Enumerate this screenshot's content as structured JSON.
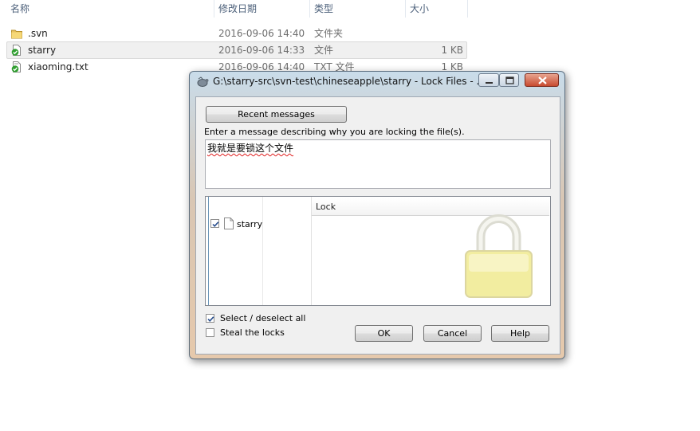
{
  "explorer": {
    "headers": {
      "name": "名称",
      "modified": "修改日期",
      "type": "类型",
      "size": "大小"
    },
    "files": [
      {
        "name": ".svn",
        "modified": "2016-09-06 14:40",
        "type": "文件夹",
        "size": "",
        "icon": "folder-icon"
      },
      {
        "name": "starry",
        "modified": "2016-09-06 14:33",
        "type": "文件",
        "size": "1 KB",
        "icon": "svn-normal-file-icon"
      },
      {
        "name": "xiaoming.txt",
        "modified": "2016-09-06 14:40",
        "type": "TXT 文件",
        "size": "1 KB",
        "icon": "svn-normal-file-icon"
      }
    ]
  },
  "dialog": {
    "title": "G:\\starry-src\\svn-test\\chineseapple\\starry - Lock Files - ...",
    "recent_messages_label": "Recent messages",
    "prompt": "Enter a message describing why you are locking the file(s).",
    "message": "我就是要锁这个文件",
    "list": {
      "lock_header": "Lock",
      "rows": [
        {
          "name": "starry",
          "checked": true
        }
      ]
    },
    "select_all_label": "Select / deselect all",
    "select_all_checked": true,
    "steal_locks_label": "Steal the locks",
    "steal_locks_checked": false,
    "ok_label": "OK",
    "cancel_label": "Cancel",
    "help_label": "Help"
  },
  "colors": {
    "dialog_frame_top": "#c9dcea",
    "dialog_frame_bottom": "#e6c9ac",
    "close_button": "#c84a2f",
    "lock_body": "#f2eda0",
    "selected_row": "#f0f0f0"
  }
}
